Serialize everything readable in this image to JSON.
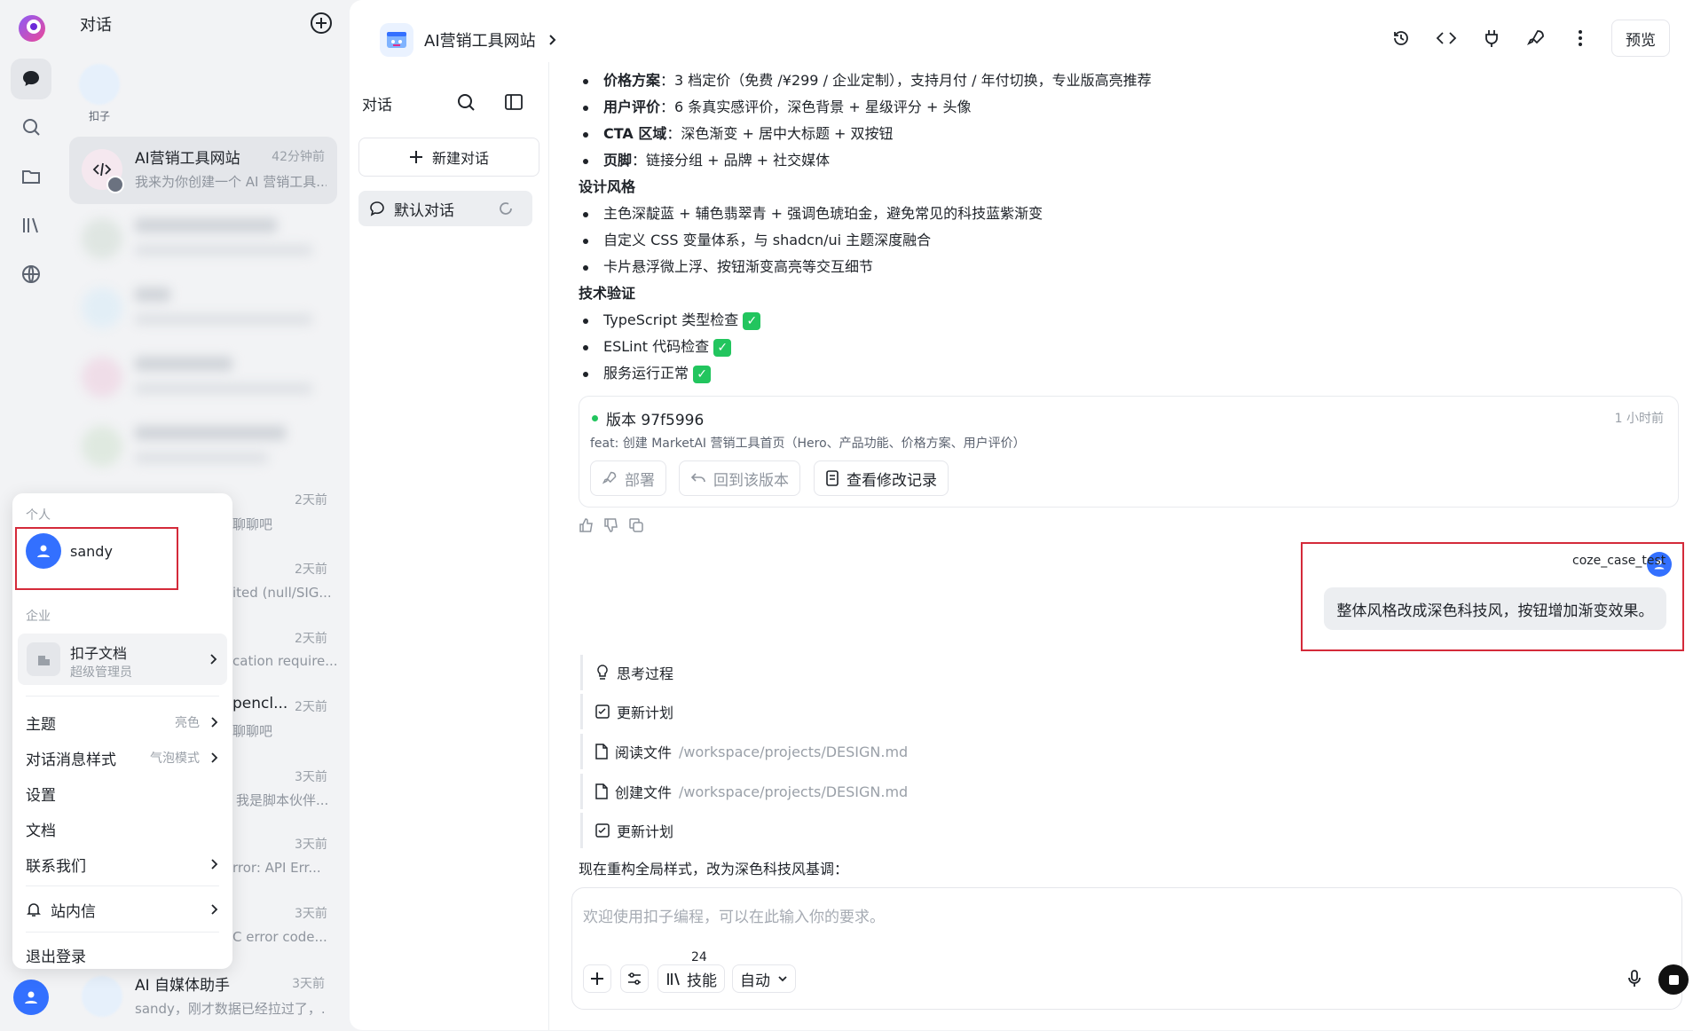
{
  "sidebar": {
    "title": "对话",
    "coze_label": "扣子",
    "conversations": [
      {
        "title": "AI营销工具网站",
        "time": "42分钟前",
        "preview": "我来为你创建一个 AI 营销工具..."
      },
      {
        "time": "2天前",
        "preview": "聊聊吧"
      },
      {
        "time": "2天前",
        "preview": "ited (null/SIG..."
      },
      {
        "time": "2天前",
        "preview": "cation require..."
      },
      {
        "title_fragment": "pencl...",
        "time": "2天前",
        "preview": "聊聊吧"
      },
      {
        "time": "3天前",
        "preview": "我是脚本伙伴..."
      },
      {
        "time": "3天前",
        "preview": "rror: API Err..."
      },
      {
        "time": "3天前",
        "preview": "C error code..."
      },
      {
        "title": "AI 自媒体助手",
        "time": "3天前",
        "preview": "sandy，刚才数据已经拉过了，..."
      }
    ]
  },
  "menu": {
    "personal_label": "个人",
    "user_name": "sandy",
    "enterprise_label": "企业",
    "org_name": "扣子文档",
    "org_role": "超级管理员",
    "theme_label": "主题",
    "theme_value": "亮色",
    "msg_style_label": "对话消息样式",
    "msg_style_value": "气泡模式",
    "settings_label": "设置",
    "docs_label": "文档",
    "contact_label": "联系我们",
    "inbox_label": "站内信",
    "logout_label": "退出登录"
  },
  "header": {
    "project_title": "AI营销工具网站",
    "preview_label": "预览"
  },
  "subpanel": {
    "title": "对话",
    "new_chat_label": "新建对话",
    "default_chat_label": "默认对话"
  },
  "content": {
    "items1": [
      {
        "label": "价格方案",
        "text": "：3 档定价（免费 /¥299 / 企业定制），支持月付 / 年付切换，专业版高亮推荐"
      },
      {
        "label": "用户评价",
        "text": "：6 条真实感评价，深色背景 + 星级评分 + 头像"
      },
      {
        "label": "CTA 区域",
        "text": "：深色渐变 + 居中大标题 + 双按钮"
      },
      {
        "label": "页脚",
        "text": "：链接分组 + 品牌 + 社交媒体"
      }
    ],
    "design_title": "设计风格",
    "design_items": [
      "主色深靛蓝 + 辅色翡翠青 + 强调色琥珀金，避免常见的科技蓝紫渐变",
      "自定义 CSS 变量体系，与 shadcn/ui 主题深度融合",
      "卡片悬浮微上浮、按钮渐变高亮等交互细节"
    ],
    "tech_title": "技术验证",
    "tech_items": [
      "TypeScript 类型检查",
      "ESLint 代码检查",
      "服务运行正常"
    ],
    "version": {
      "label": "版本 97f5996",
      "time": "1 小时前",
      "desc": "feat: 创建 MarketAI 营销工具首页（Hero、产品功能、价格方案、用户评价）",
      "deploy": "部署",
      "rollback": "回到该版本",
      "view_changes": "查看修改记录"
    },
    "user_msg": {
      "name": "coze_case_test",
      "text": "整体风格改成深色科技风，按钮增加渐变效果。"
    },
    "steps": [
      {
        "label": "思考过程",
        "path": "",
        "icon": "bulb-icon"
      },
      {
        "label": "更新计划",
        "path": "",
        "icon": "plan-icon"
      },
      {
        "label": "阅读文件",
        "path": "/workspace/projects/DESIGN.md",
        "icon": "file-icon"
      },
      {
        "label": "创建文件",
        "path": "/workspace/projects/DESIGN.md",
        "icon": "file-icon"
      },
      {
        "label": "更新计划",
        "path": "",
        "icon": "plan-icon"
      }
    ],
    "status_text": "现在重构全局样式，改为深色科技风基调："
  },
  "composer": {
    "placeholder": "欢迎使用扣子编程，可以在此输入你的要求。",
    "skills_label": "技能",
    "skills_count": "24",
    "mode_label": "自动"
  },
  "colors": {
    "accent": "#3370ff",
    "highlight": "#d42a3a",
    "green": "#22c55e"
  }
}
